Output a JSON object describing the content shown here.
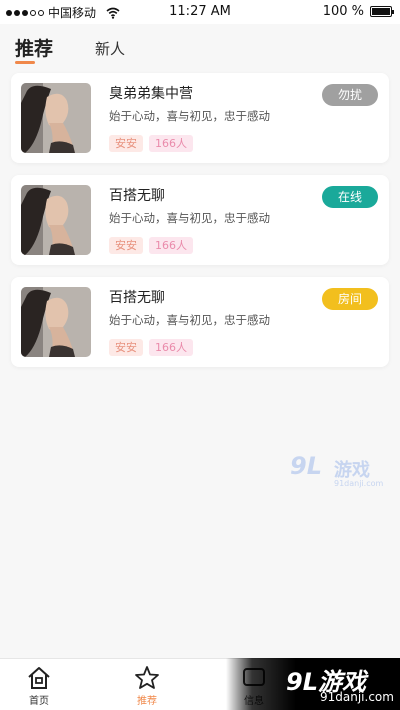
{
  "status_bar": {
    "carrier": "中国移动",
    "time": "11:27 AM",
    "battery": "100 %",
    "battery_level": 1.0,
    "signal_bars_filled": 3,
    "signal_bars_total": 5
  },
  "header": {
    "tabs": [
      {
        "label": "推荐",
        "active": true
      },
      {
        "label": "新人",
        "active": false
      }
    ],
    "accent_color": "#f0884a"
  },
  "rooms": [
    {
      "title": "臭弟弟集中营",
      "subtitle": "始于心动，喜与初见，忠于感动",
      "tags": [
        "安安",
        "166人"
      ],
      "status": "勿扰",
      "status_color": "#a0a0a0"
    },
    {
      "title": "百搭无聊",
      "subtitle": "始于心动，喜与初见，忠于感动",
      "tags": [
        "安安",
        "166人"
      ],
      "status": "在线",
      "status_color": "#1aa99a"
    },
    {
      "title": "百搭无聊",
      "subtitle": "始于心动，喜与初见，忠于感动",
      "tags": [
        "安安",
        "166人"
      ],
      "status": "房间",
      "status_color": "#f2bf1e"
    }
  ],
  "watermark": {
    "number": "9L",
    "text": "游戏",
    "url": "91danji.com"
  },
  "tab_bar": {
    "items": [
      {
        "label": "首页",
        "icon": "home-icon"
      },
      {
        "label": "推荐",
        "icon": "star-icon",
        "active": true
      },
      {
        "label": "信息",
        "icon": "message-icon"
      }
    ]
  },
  "brand_banner": {
    "text": "9L游戏",
    "url": "91danji.com"
  }
}
